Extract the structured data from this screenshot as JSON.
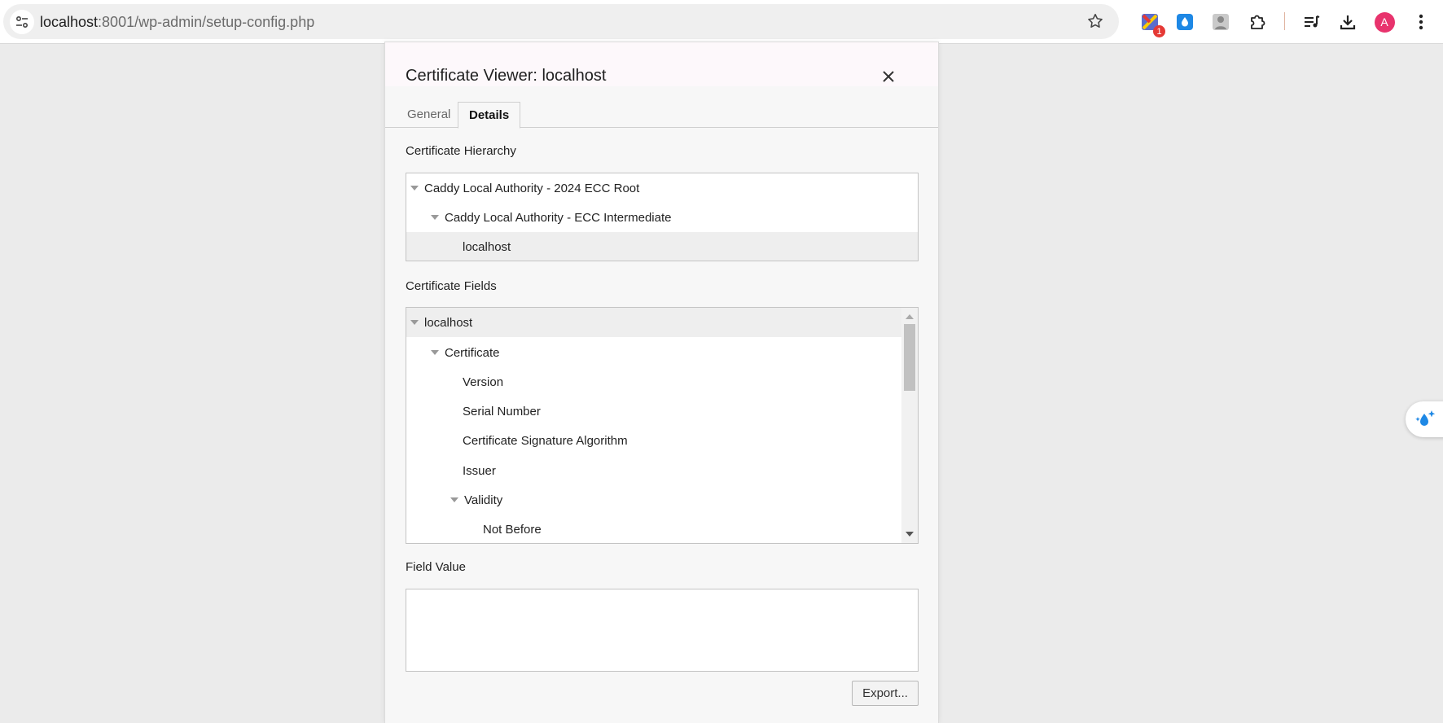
{
  "browser": {
    "url_host": "localhost",
    "url_path": ":8001/wp-admin/setup-config.php",
    "extension_badge": "1",
    "profile_initial": "A",
    "icons": [
      "site-info-icon",
      "bookmark-star-icon",
      "extension-icon",
      "water-drop-icon",
      "profile-extension-icon",
      "puzzle-icon",
      "media-queue-icon",
      "download-icon",
      "avatar",
      "kebab-menu-icon"
    ]
  },
  "dialog": {
    "title": "Certificate Viewer: localhost",
    "tabs": [
      {
        "label": "General",
        "active": false
      },
      {
        "label": "Details",
        "active": true
      }
    ],
    "hierarchy_label": "Certificate Hierarchy",
    "hierarchy": [
      {
        "label": "Caddy Local Authority - 2024 ECC Root",
        "level": 0,
        "expanded": true,
        "selected": false
      },
      {
        "label": "Caddy Local Authority - ECC Intermediate",
        "level": 1,
        "expanded": true,
        "selected": false
      },
      {
        "label": "localhost",
        "level": 2,
        "expanded": null,
        "selected": true
      }
    ],
    "fields_label": "Certificate Fields",
    "fields": [
      {
        "label": "localhost",
        "level": 0,
        "expanded": true,
        "selected": true
      },
      {
        "label": "Certificate",
        "level": 1,
        "expanded": true,
        "selected": false
      },
      {
        "label": "Version",
        "level": 2,
        "expanded": null,
        "selected": false
      },
      {
        "label": "Serial Number",
        "level": 2,
        "expanded": null,
        "selected": false
      },
      {
        "label": "Certificate Signature Algorithm",
        "level": 2,
        "expanded": null,
        "selected": false
      },
      {
        "label": "Issuer",
        "level": 2,
        "expanded": null,
        "selected": false
      },
      {
        "label": "Validity",
        "level": 2,
        "expanded": true,
        "selected": false
      },
      {
        "label": "Not Before",
        "level": 3,
        "expanded": null,
        "selected": false
      }
    ],
    "field_value_label": "Field Value",
    "field_value": "",
    "export_label": "Export..."
  },
  "colors": {
    "page_bg": "#ebebeb",
    "dialog_bg": "#f7f7f7",
    "selected_row": "#eeeeee",
    "avatar": "#e8336d",
    "badge": "#e53935"
  }
}
